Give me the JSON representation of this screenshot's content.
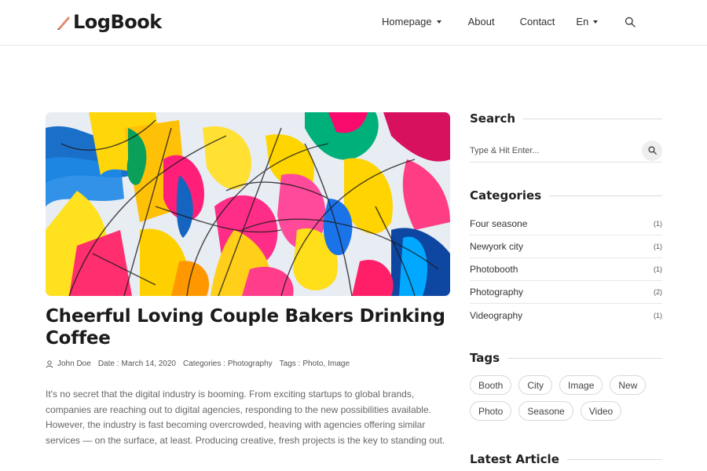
{
  "header": {
    "logo": "LogBook",
    "nav": {
      "homepage": "Homepage",
      "about": "About",
      "contact": "Contact",
      "language": "En"
    }
  },
  "post": {
    "title": "Cheerful Loving Couple Bakers Drinking Coffee",
    "author": "John Doe",
    "date_label": "Date :",
    "date": "March 14, 2020",
    "categories_label": "Categories :",
    "category": "Photography",
    "tags_label": "Tags :",
    "tag1": "Photo",
    "tag_sep": ",",
    "tag2": "Image",
    "excerpt": "It's no secret that the digital industry is booming. From exciting startups to global brands, companies are reaching out to digital agencies, responding to the new possibilities available. However, the industry is fast becoming overcrowded, heaving with agencies offering similar services — on the surface, at least. Producing creative, fresh projects is the key to standing out."
  },
  "sidebar": {
    "search": {
      "heading": "Search",
      "placeholder": "Type & Hit Enter..."
    },
    "categories": {
      "heading": "Categories",
      "items": [
        {
          "label": "Four seasone",
          "count": "(1)"
        },
        {
          "label": "Newyork city",
          "count": "(1)"
        },
        {
          "label": "Photobooth",
          "count": "(1)"
        },
        {
          "label": "Photography",
          "count": "(2)"
        },
        {
          "label": "Videography",
          "count": "(1)"
        }
      ]
    },
    "tags": {
      "heading": "Tags",
      "items": [
        "Booth",
        "City",
        "Image",
        "New",
        "Photo",
        "Seasone",
        "Video"
      ]
    },
    "latest": {
      "heading": "Latest Article"
    }
  },
  "colors": {
    "accent": "#e8556a",
    "text": "#222222",
    "muted": "#666666",
    "border": "#e2e2e2"
  }
}
